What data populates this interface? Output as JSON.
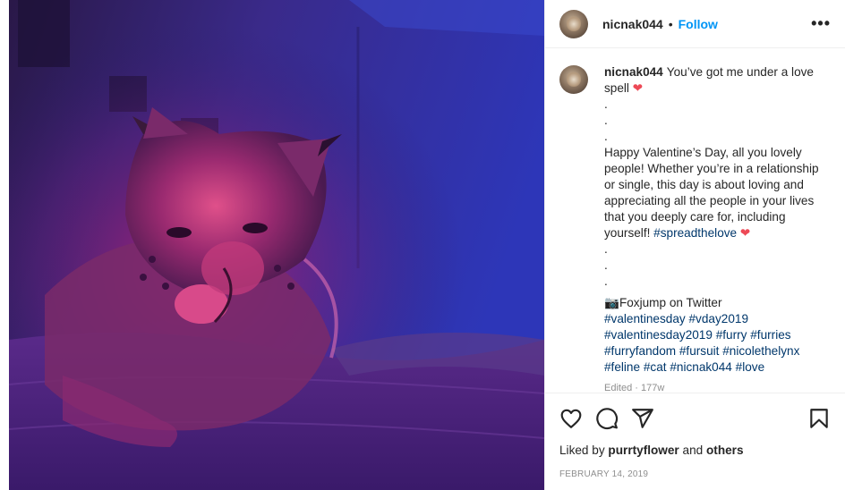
{
  "post": {
    "image_alt": "Lynx fursuit lying on a bed under purple and red lighting",
    "colors": {
      "primary_blue": "#0095f6",
      "hashtag": "#00376b",
      "heart": "#ed4956",
      "muted": "#8e8e8e"
    }
  },
  "header": {
    "username": "nicnak044",
    "separator": "•",
    "follow_label": "Follow",
    "more_icon": "more-dots-icon",
    "more_label": "•••"
  },
  "caption": {
    "username": "nicnak044",
    "first_line": "You’ve got me under a love spell",
    "heart": "❤",
    "dots1": [
      ".",
      " .",
      " ."
    ],
    "body": "Happy Valentine’s Day, all you lovely people! Whether you’re in a relationship or single, this day is about loving and appreciating all the people in your lives that you deeply care for, including yourself!",
    "body_tag": "#spreadthelove",
    "body_heart": "❤",
    "dots2": [
      ".",
      ".",
      "."
    ],
    "camera_icon": "📷",
    "credit": "Foxjump on Twitter",
    "hashtags": [
      "#valentinesday",
      "#vday2019",
      "#valentinesday2019",
      "#furry",
      "#furries",
      "#furryfandom",
      "#fursuit",
      "#nicolethelynx",
      "#feline",
      "#cat",
      "#nicnak044",
      "#love"
    ],
    "edited": "Edited · 177w"
  },
  "actions": {
    "like_icon": "heart-icon",
    "comment_icon": "comment-icon",
    "share_icon": "share-icon",
    "save_icon": "bookmark-icon"
  },
  "likes": {
    "prefix": "Liked by",
    "user": "purrtyflower",
    "middle": "and",
    "suffix": "others"
  },
  "date": "FEBRUARY 14, 2019"
}
